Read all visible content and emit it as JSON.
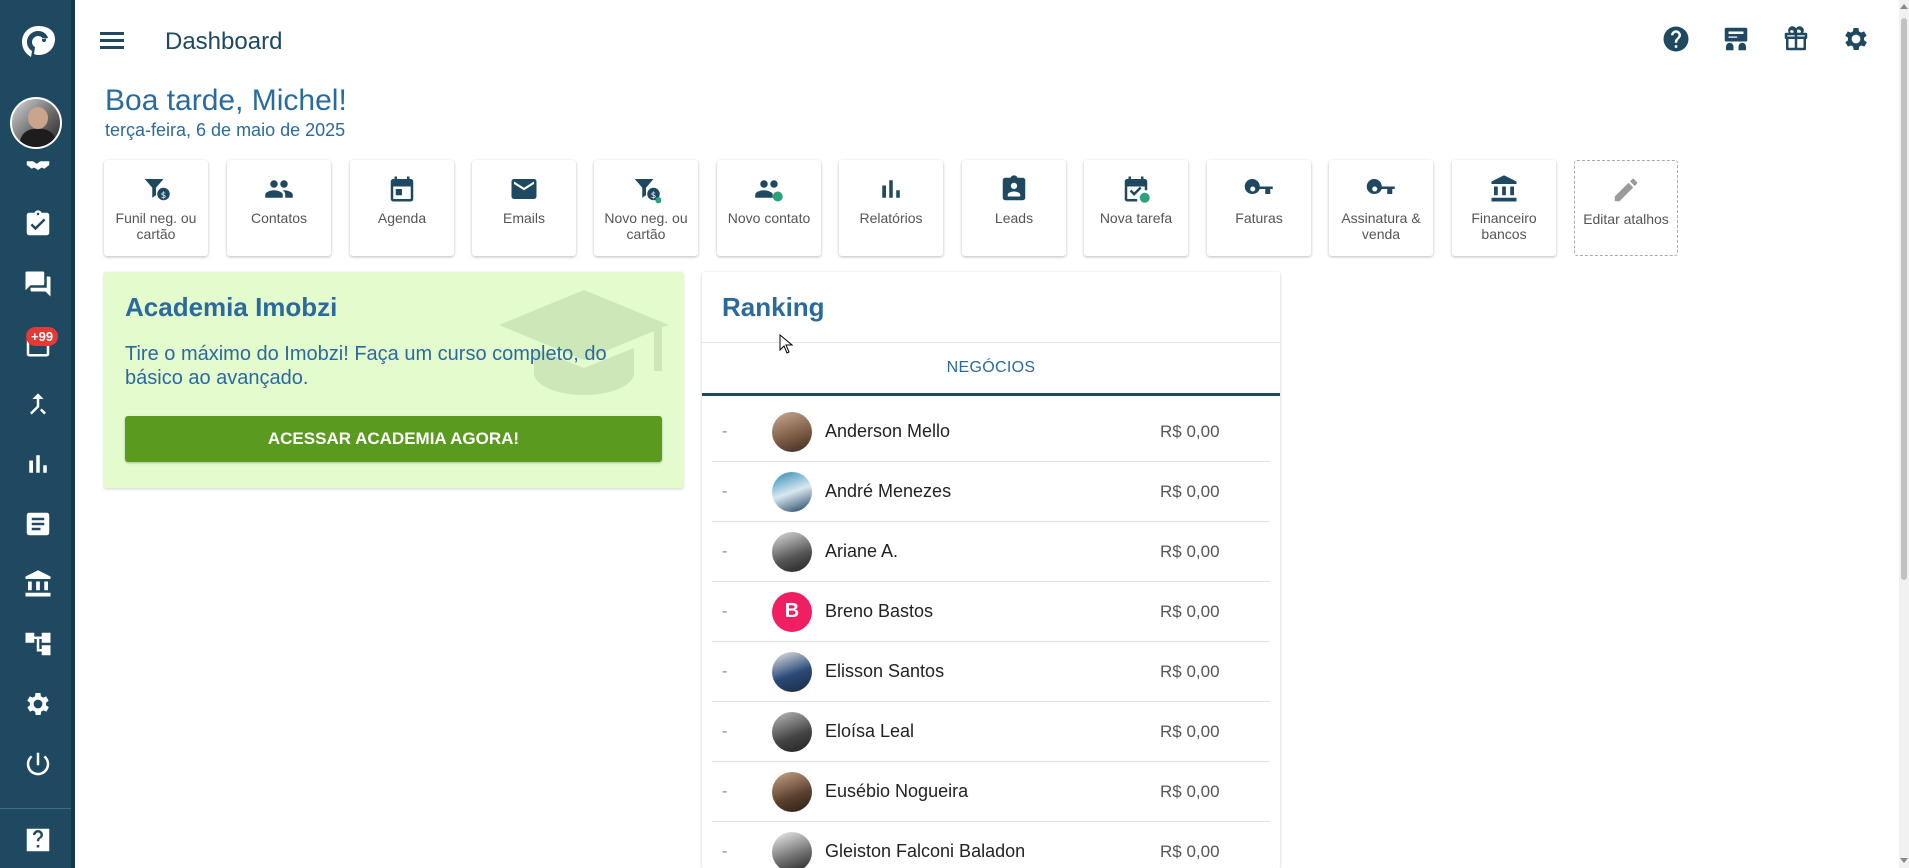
{
  "sidebar": {
    "notification_badge": "+99"
  },
  "header": {
    "title": "Dashboard"
  },
  "greeting": {
    "title": "Boa tarde, Michel!",
    "date": "terça-feira, 6 de maio de 2025"
  },
  "shortcuts": [
    {
      "label": "Funil neg. ou cartão",
      "icon": "funnel-money-icon"
    },
    {
      "label": "Contatos",
      "icon": "people-icon"
    },
    {
      "label": "Agenda",
      "icon": "calendar-icon"
    },
    {
      "label": "Emails",
      "icon": "mail-icon"
    },
    {
      "label": "Novo neg. ou cartão",
      "icon": "funnel-add-icon"
    },
    {
      "label": "Novo contato",
      "icon": "people-add-icon"
    },
    {
      "label": "Relatórios",
      "icon": "bar-chart-icon"
    },
    {
      "label": "Leads",
      "icon": "contact-badge-icon"
    },
    {
      "label": "Nova tarefa",
      "icon": "calendar-check-icon"
    },
    {
      "label": "Faturas",
      "icon": "key-icon"
    },
    {
      "label": "Assinatura & venda",
      "icon": "key-icon"
    },
    {
      "label": "Financeiro bancos",
      "icon": "bank-icon"
    },
    {
      "label": "Editar atalhos",
      "icon": "pencil-icon"
    }
  ],
  "academia": {
    "title": "Academia Imobzi",
    "text": "Tire o máximo do Imobzi! Faça um curso completo, do básico ao avançado.",
    "button": "ACESSAR ACADEMIA AGORA!"
  },
  "ranking": {
    "title": "Ranking",
    "tab": "NEGÓCIOS",
    "rows": [
      {
        "pos": "-",
        "name": "Anderson Mello",
        "value": "R$ 0,00"
      },
      {
        "pos": "-",
        "name": "André Menezes",
        "value": "R$ 0,00"
      },
      {
        "pos": "-",
        "name": "Ariane A.",
        "value": "R$ 0,00"
      },
      {
        "pos": "-",
        "name": "Breno Bastos",
        "value": "R$ 0,00",
        "initial": "B"
      },
      {
        "pos": "-",
        "name": "Elisson Santos",
        "value": "R$ 0,00"
      },
      {
        "pos": "-",
        "name": "Eloísa Leal",
        "value": "R$ 0,00"
      },
      {
        "pos": "-",
        "name": "Eusébio Nogueira",
        "value": "R$ 0,00"
      },
      {
        "pos": "-",
        "name": "Gleiston Falconi Baladon",
        "value": "R$ 0,00"
      }
    ]
  }
}
